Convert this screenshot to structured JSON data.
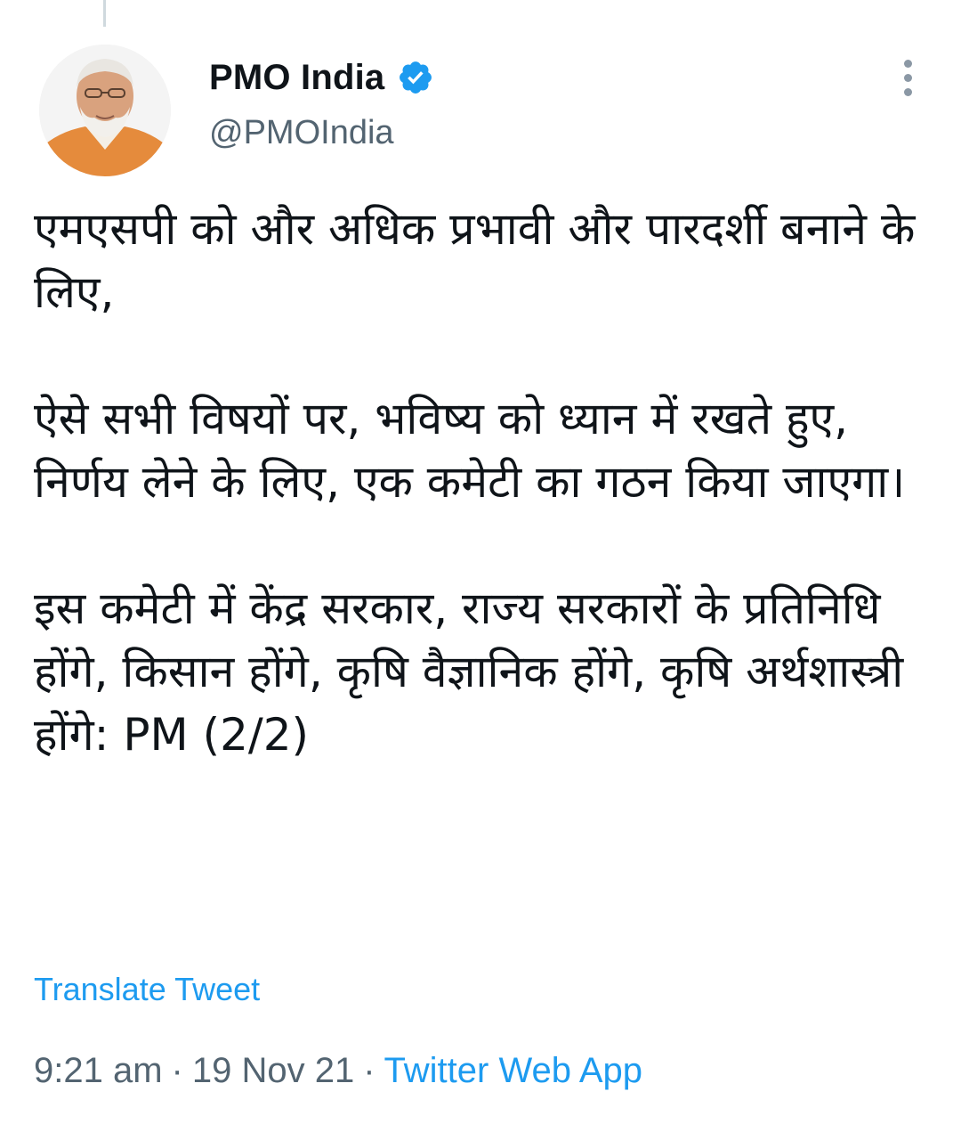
{
  "tweet": {
    "author": {
      "display_name": "PMO India",
      "handle": "@PMOIndia",
      "verified": true
    },
    "paragraphs": [
      "एमएसपी को और अधिक प्रभावी और पारदर्शी बनाने के लिए,",
      "ऐसे सभी विषयों पर, भविष्य को ध्यान में रखते हुए, निर्णय लेने के लिए, एक कमेटी का गठन किया जाएगा।",
      "इस कमेटी में केंद्र सरकार, राज्य सरकारों के प्रतिनिधि होंगे, किसान होंगे, कृषि वैज्ञानिक होंगे, कृषि अर्थशास्त्री होंगे: PM (2/2)"
    ],
    "translate_label": "Translate Tweet",
    "time": "9:21 am",
    "separator": "·",
    "date": "19 Nov 21",
    "source": "Twitter Web App"
  },
  "icons": {
    "verified": "verified-badge-icon",
    "more": "more-options-icon"
  },
  "colors": {
    "link": "#1d9bf0",
    "secondary_text": "#536471",
    "primary_text": "#0f1419",
    "verified_badge": "#1d9bf0"
  }
}
